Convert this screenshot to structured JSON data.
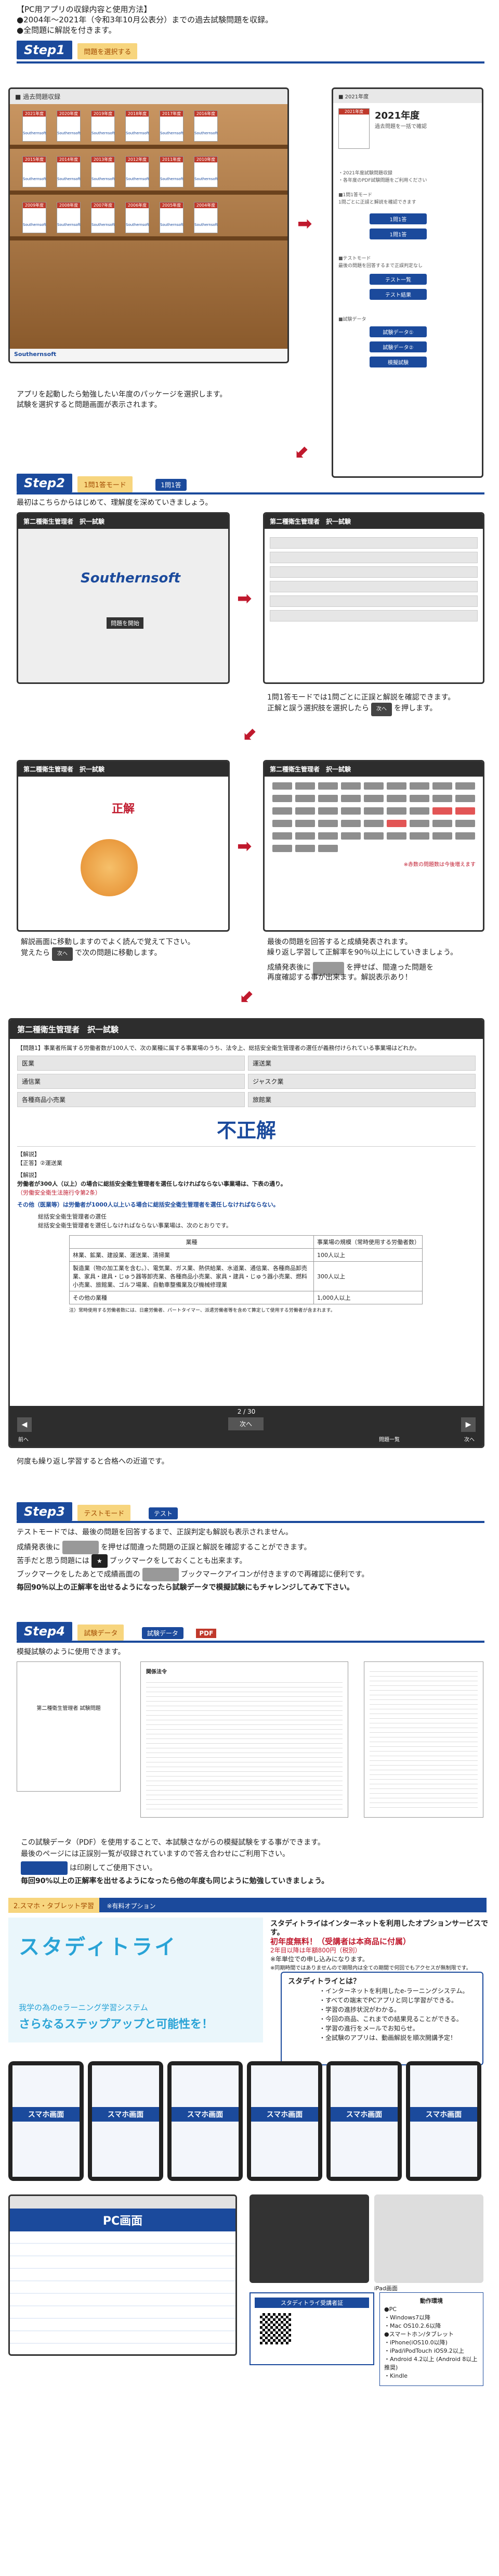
{
  "header": {
    "line1": "【PC用アプリの収録内容と使用方法】",
    "line2": "●2004年～2021年（令和3年10月公表分）までの過去試験問題を収録。",
    "line3": "●全問題に解説を付きます。"
  },
  "step1": {
    "badge": "Step1",
    "tag": "問題を選択する",
    "caption1": "アプリを起動したら勉強したい年度のパッケージを選択します。",
    "caption2": "試験を選択すると問題画面が表示されます。",
    "books": [
      "2021年度",
      "2020年度",
      "2019年度",
      "2018年度",
      "2017年度",
      "2016年度",
      "2015年度",
      "2014年度",
      "2013年度",
      "2012年度",
      "2011年度",
      "2010年度",
      "2009年度",
      "2008年度",
      "2007年度",
      "2006年度",
      "2005年度",
      "2004年度"
    ],
    "book_sub": "Southernsoft",
    "logo": "Southernsoft",
    "year_panel": {
      "title": "2021年度",
      "sub": "過去問題を一括で確認",
      "btn1": "1問1答",
      "btn2": "1問1答",
      "btn3": "テスト一覧",
      "btn4": "テスト結果",
      "btn5": "試験データ①",
      "btn6": "試験データ②",
      "btn7": "模擬試験"
    }
  },
  "step2": {
    "badge": "Step2",
    "tag": "1問1答モード",
    "btn": "1問1答",
    "intro": "最初はこちらからはじめて、理解度を深めていきましょう。",
    "screen_title": "第二種衛生管理者　択一試験",
    "logo": "Southernsoft",
    "start_btn": "問題を開始",
    "caption_a1": "1問1答モードでは1問ごとに正誤と解説を確認できます。",
    "caption_a2": "正解と誤う選択肢を選択したら",
    "caption_a3": "を押します。",
    "incorrect": "正解",
    "caption_b1": "解説画面に移動しますのでよく読んで覚えて下さい。",
    "caption_b2": "覚えたら",
    "caption_b3": "で次の問題に移動します。",
    "caption_c1": "最後の問題を回答すると成績発表されます。",
    "caption_c2": "繰り返し学習して正解率を90％以上にしていきましょう。",
    "caption_c3": "成績発表後に",
    "caption_c4": "を押せば、間違った問題を",
    "caption_c5": "再度確認する事が出来ます。解説表示あり！",
    "grid_note": "※赤数の問題数は今後増えます"
  },
  "bigscreen": {
    "title": "第二種衛生管理者　択一試験",
    "question": "【問題1】事業者所属する労働者数が100人で、次の業種に属する事業場のうち、法令上、総括安全衛生管理者の選任が義務付けられている事業場はどれか。",
    "options": [
      "医業",
      "運送業",
      "通信業",
      "ジャスク業",
      "各種商品小売業",
      "旅館業"
    ],
    "verdict": "不正解",
    "verdict_ghost": "不正解",
    "answer_label": "【解説】",
    "answer_value": "【正答】②運送業",
    "ex1": "【解説】",
    "ex2": "労働者が300人（以上）の場合に総括安全衛生管理者を選任しなければならない事業場は、下表の通り。",
    "ex3": "（労働安全衛生法施行令第2条）",
    "ex4": "その他（医業等）は労働者が1000人以上いる場合に総括安全衛生管理者を選任しなければならない。",
    "ex5": "総括安全衛生管理者の選任",
    "ex6": "総括安全衛生管理者を選任しなければならない事業場は、次のとおりです。",
    "th1": "業種",
    "th2": "事業場の規模（常時使用する労働者数）",
    "rows": [
      [
        "林業、鉱業、建設業、運送業、清掃業",
        "100人以上"
      ],
      [
        "製造業（物の加工業を含む。）、電気業、ガス業、熱供給業、水道業、通信業、各種商品卸売業、家具・建具・じゅう器等卸売業、各種商品小売業、家具・建具・じゅう器小売業、燃料小売業、旅館業、ゴルフ場業、自動車整備業及び機械修理業",
        "300人以上"
      ],
      [
        "その他の業種",
        "1,000人以上"
      ]
    ],
    "note": "注）常時使用する労働者数には、日雇労働者、パートタイマー、派遣労働者等を含めて算定して使用する労働者が含まれます。",
    "page": "2 / 30",
    "next": "次へ",
    "nav_prev": "前へ",
    "nav_list": "問題一覧",
    "nav_next": "次へ"
  },
  "repeat_caption": "何度も繰り返し学習すると合格への近道です。",
  "step3": {
    "badge": "Step3",
    "tag": "テストモード",
    "btn": "テスト",
    "l1": "テストモードでは、最後の問題を回答するまで、正誤判定も解説も表示されません。",
    "l2a": "成績発表後に",
    "l2b": "を押せば間違った問題の正誤と解説を確認することができます。",
    "l3a": "苦手だと思う問題には",
    "l3b": "ブックマークをしておくことも出来ます。",
    "l4a": "ブックマークをしたあとで成績画面の",
    "l4b": "ブックマークアイコンが付きますので再確認に便利です。",
    "l5": "毎回90％以上の正解率を出せるようになったら試験データで模擬試験にもチャレンジしてみて下さい。"
  },
  "step4": {
    "badge": "Step4",
    "tag": "試験データ",
    "btn": "試験データ",
    "pdf": "PDF",
    "intro": "模擬試験のように使用できます。",
    "doc1_title": "第二種衛生管理者 試験問題",
    "doc2_title": "関係法令",
    "l1": "この試験データ（PDF）を使用することで、本試験さながらの模擬試験をする事ができます。",
    "l2": "最後のページには正誤別一覧が収録されていますので答え合わせにご利用下さい。",
    "l3a": "",
    "l3b": "は印刷してご使用下さい。",
    "l4": "毎回90%以上の正解率を出せるようになったら他の年度も同じように勉強していきましょう。"
  },
  "option": {
    "badge": "2.スマホ・タブレット学習",
    "tag": "※有料オプション",
    "brand": "スタディトライ",
    "tagline1": "我学の為のeラーニング学習システム",
    "tagline2": "さらなるステップアップと可能性を！",
    "desc1": "スタディトライはインターネットを利用したオプションサービスです。",
    "desc2": "初年度無料！（受講者は本商品に付属）",
    "desc3": "2年目以降は年額800円（税別）",
    "desc4": "※年単位での申し込みになります。",
    "desc5": "※同期時間ではありませんので期限内は全ての期間で何回でもアクセスが無制限です。",
    "what_title": "スタディトライとは？",
    "what": [
      "・インターネットを利用したe-ラーニングシステム。",
      "・すべての端末でPCアプリと同じ学習ができる。",
      "・学習の進捗状況がわかる。",
      "・今回の商品、これまでの結果見ることができる。",
      "・学習の進行をメールでお知らせ。",
      "・全試験のアプリは、動画解説を順次開講予定！"
    ],
    "phone_label": "スマホ画面",
    "pc_label": "PC画面",
    "tablet_label": "PC画面",
    "dl_title": "スタディトライ受講者証",
    "env_title": "動作環境",
    "env": [
      "●PC",
      "・Windows7以降",
      "・Mac OS10.2.6以降",
      "●スマートホン/タブレット",
      "・iPhone(iOS10.0以降)",
      "・iPad/iPodTouch iOS9.2以上",
      "・Android 4.2以上 (Android 8以上推奨)",
      "・Kindle"
    ],
    "tablet_cap": "iPad画面"
  },
  "colors": {
    "accent": "#1b4a9c",
    "red": "#c0192d",
    "tag": "#f7d57e",
    "green": "#3a9a3a"
  }
}
